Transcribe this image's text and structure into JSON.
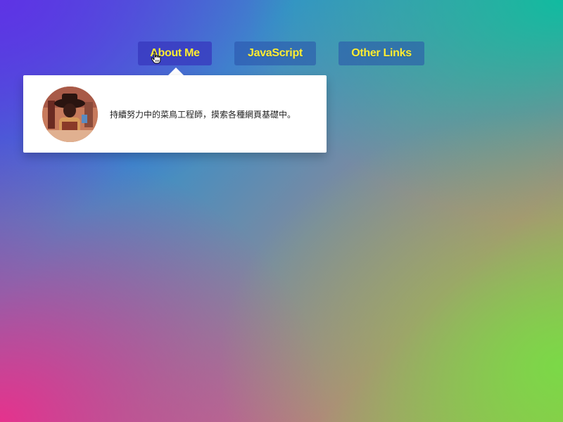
{
  "nav": {
    "items": [
      {
        "label": "About Me"
      },
      {
        "label": "JavaScript"
      },
      {
        "label": "Other Links"
      }
    ],
    "active_index": 0,
    "link_color": "#ffee33"
  },
  "dropdown": {
    "bio": "持續努力中的菜鳥工程師，摸索各種網頁基礎中。"
  },
  "icons": {
    "cursor": "hand-pointer-icon"
  },
  "background": {
    "colors": [
      "#5f32e6",
      "#0abea0",
      "#78dc46",
      "#e8308c"
    ]
  }
}
